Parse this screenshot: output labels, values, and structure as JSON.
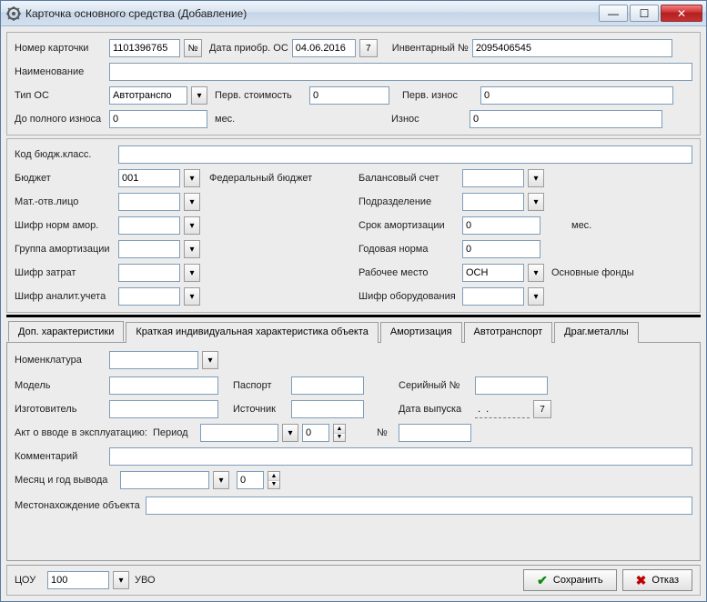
{
  "window": {
    "title": "Карточка основного средства (Добавление)"
  },
  "top": {
    "card_num_label": "Номер карточки",
    "card_num": "1101396765",
    "card_num_btn": "№",
    "date_label": "Дата приобр. ОС",
    "date": "04.06.2016",
    "date_btn": "7",
    "inv_label": "Инвентарный №",
    "inv": "2095406545",
    "name_label": "Наименование",
    "name": "",
    "type_label": "Тип ОС",
    "type": "Автотранспо",
    "first_cost_label": "Перв. стоимость",
    "first_cost": "0",
    "first_wear_label": "Перв. износ",
    "first_wear": "0",
    "full_wear_label": "До полного износа",
    "full_wear_val": "0",
    "full_wear_unit": "мес.",
    "wear_label": "Износ",
    "wear_val": "0"
  },
  "mid": {
    "kbk_label": "Код бюдж.класс.",
    "kbk": "",
    "budget_label": "Бюджет",
    "budget_val": "001",
    "budget_desc": "Федеральный бюджет",
    "balance_label": "Балансовый счет",
    "matotv_label": "Мат.-отв.лицо",
    "subdiv_label": "Подразделение",
    "shifr_amort_label": "Шифр норм амор.",
    "amort_period_label": "Срок амортизации",
    "amort_period_val": "0",
    "amort_period_unit": "мес.",
    "amort_group_label": "Группа амортизации",
    "year_norm_label": "Годовая норма",
    "year_norm_val": "0",
    "shifr_cost_label": "Шифр затрат",
    "workplace_label": "Рабочее место",
    "workplace_val": "ОСН",
    "workplace_desc": "Основные фонды",
    "shifr_anal_label": "Шифр аналит.учета",
    "shifr_equip_label": "Шифр оборудования"
  },
  "tabs": {
    "t0": "Доп. характеристики",
    "t1": "Краткая индивидуальная характеристика объекта",
    "t2": "Амортизация",
    "t3": "Автотранспорт",
    "t4": "Драг.металлы"
  },
  "detail": {
    "nomen_label": "Номенклатура",
    "model_label": "Модель",
    "passport_label": "Паспорт",
    "serial_label": "Серийный №",
    "maker_label": "Изготовитель",
    "source_label": "Источник",
    "release_label": "Дата выпуска",
    "release_date": ".  .",
    "release_btn": "7",
    "act_label": "Акт о вводе в эксплуатацию:",
    "period_label": "Период",
    "period_num": "0",
    "numero_label": "№",
    "comment_label": "Комментарий",
    "month_year_label": "Месяц и год вывода",
    "month_year_num": "0",
    "location_label": "Местонахождение объекта"
  },
  "bottom": {
    "tsou_label": "ЦОУ",
    "tsou_val": "100",
    "uvo_label": "УВО",
    "save": "Сохранить",
    "cancel": "Отказ"
  }
}
